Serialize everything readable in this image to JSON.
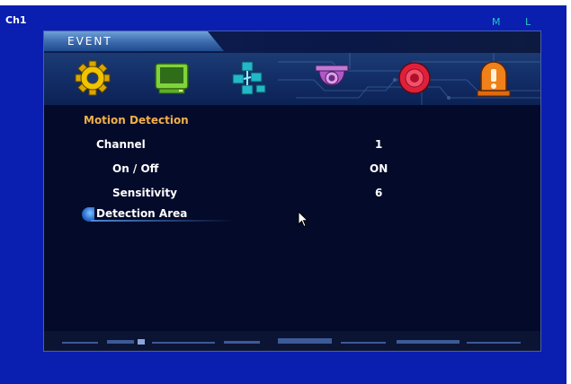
{
  "screen": {
    "channel_label": "Ch1",
    "mode_left": "M",
    "mode_right": "L"
  },
  "menu": {
    "title": "EVENT",
    "icons": [
      {
        "name": "gear-icon",
        "color": "#e6b800"
      },
      {
        "name": "monitor-icon",
        "color": "#7fd43a"
      },
      {
        "name": "network-icon",
        "color": "#22b7c9"
      },
      {
        "name": "dome-camera-icon",
        "color": "#b058c8"
      },
      {
        "name": "record-icon",
        "color": "#e0203a"
      },
      {
        "name": "alarm-icon",
        "color": "#f0801a"
      }
    ],
    "section_title": "Motion Detection",
    "items": [
      {
        "label": "Channel",
        "value": "1"
      },
      {
        "label": "On / Off",
        "value": "ON"
      },
      {
        "label": "Sensitivity",
        "value": "6"
      },
      {
        "label": "Detection Area",
        "value": ""
      }
    ]
  },
  "colors": {
    "background": "#0a1fb0",
    "panel": "#040a2a",
    "section_accent": "#f0b046",
    "text": "#ffffff"
  }
}
